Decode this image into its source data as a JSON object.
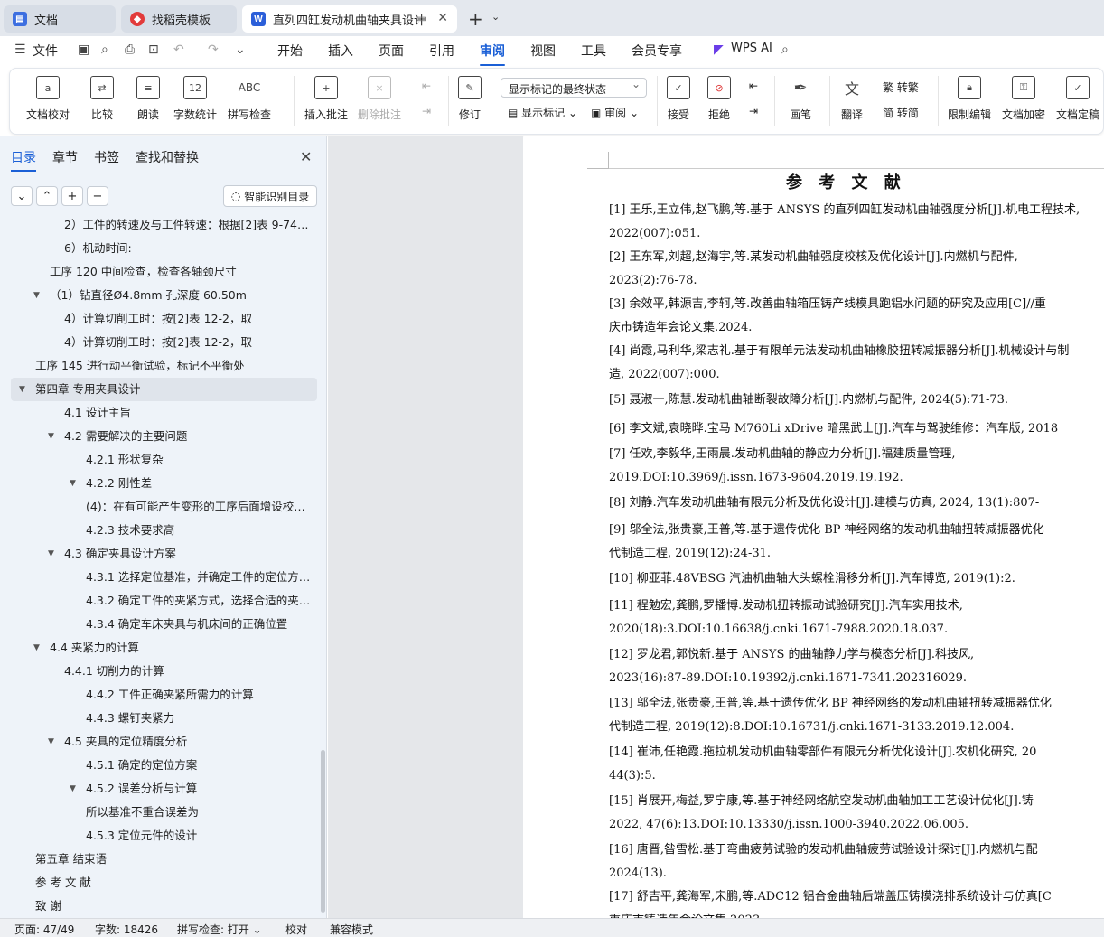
{
  "tabs": [
    {
      "label": "文档",
      "icon": "document-icon"
    },
    {
      "label": "找稻壳模板",
      "icon": "docer-icon"
    },
    {
      "label": "直列四缸发动机曲轴夹具设计",
      "icon": "word-icon"
    }
  ],
  "menu": {
    "file": "文件",
    "items": [
      "开始",
      "插入",
      "页面",
      "引用",
      "审阅",
      "视图",
      "工具",
      "会员专享"
    ],
    "active": "审阅",
    "wps_ai": "WPS AI"
  },
  "ribbon": {
    "proofread": "文档校对",
    "compare": "比较",
    "read_aloud": "朗读",
    "word_count": "字数统计",
    "word_count_glyph": "12",
    "spell_check": "拼写检查",
    "spell_glyph": "ABC",
    "insert_comment": "插入批注",
    "delete_comment": "删除批注",
    "revise": "修订",
    "markup_state": "显示标记的最终状态",
    "show_markup": "显示标记",
    "review": "审阅",
    "accept": "接受",
    "reject": "拒绝",
    "pen": "画笔",
    "translate": "翻译",
    "to_traditional": "转繁",
    "to_simplified": "转简",
    "restrict_edit": "限制编辑",
    "encrypt": "文档加密",
    "finalize": "文档定稿"
  },
  "nav": {
    "tabs": [
      "目录",
      "章节",
      "书签",
      "查找和替换"
    ],
    "active_tab": "目录",
    "smart_toc": "智能识别目录",
    "toc": [
      {
        "text": "2）工件的转速及与工件转速：根据[2]表 9-74，…",
        "indent": 2,
        "caret": false,
        "sel": false
      },
      {
        "text": "6）机动时间:",
        "indent": 2,
        "caret": false,
        "sel": false
      },
      {
        "text": "工序 120 中间检查，检查各轴颈尺寸",
        "indent": 1,
        "caret": false,
        "sel": false
      },
      {
        "text": "（1）钻直径Ø4.8mm 孔深度 60.50m",
        "indent": 1,
        "caret": true,
        "sel": false
      },
      {
        "text": "4）计算切削工时：按[2]表 12-2，取",
        "indent": 2,
        "caret": false,
        "sel": false
      },
      {
        "text": "4）计算切削工时：按[2]表 12-2，取",
        "indent": 2,
        "caret": false,
        "sel": false
      },
      {
        "text": "工序 145 进行动平衡试验，标记不平衡处",
        "indent": 0,
        "caret": false,
        "sel": false
      },
      {
        "text": "第四章   专用夹具设计",
        "indent": 0,
        "caret": true,
        "sel": true
      },
      {
        "text": "4.1   设计主旨",
        "indent": 2,
        "caret": false,
        "sel": false
      },
      {
        "text": "4.2   需要解决的主要问题",
        "indent": 2,
        "caret": true,
        "sel": false
      },
      {
        "text": "4.2.1   形状复杂",
        "indent": 3,
        "caret": false,
        "sel": false
      },
      {
        "text": "4.2.2   刚性差",
        "indent": 3,
        "caret": true,
        "sel": false
      },
      {
        "text": "(4)：在有可能产生变形的工序后面增设校…",
        "indent": 3,
        "caret": false,
        "sel": false
      },
      {
        "text": "4.2.3   技术要求高",
        "indent": 3,
        "caret": false,
        "sel": false
      },
      {
        "text": "4.3   确定夹具设计方案",
        "indent": 2,
        "caret": true,
        "sel": false
      },
      {
        "text": "4.3.1   选择定位基准，并确定工件的定位方…",
        "indent": 3,
        "caret": false,
        "sel": false
      },
      {
        "text": "4.3.2  确定工件的夹紧方式，选择合适的夹…",
        "indent": 3,
        "caret": false,
        "sel": false
      },
      {
        "text": "4.3.4   确定车床夹具与机床间的正确位置",
        "indent": 3,
        "caret": false,
        "sel": false
      },
      {
        "text": "4.4 夹紧力的计算",
        "indent": 1,
        "caret": true,
        "sel": false
      },
      {
        "text": "4.4.1 切削力的计算",
        "indent": 2,
        "caret": false,
        "sel": false
      },
      {
        "text": "4.4.2   工件正确夹紧所需力的计算",
        "indent": 3,
        "caret": false,
        "sel": false
      },
      {
        "text": "4.4.3   螺钉夹紧力",
        "indent": 3,
        "caret": false,
        "sel": false
      },
      {
        "text": "4.5   夹具的定位精度分析",
        "indent": 2,
        "caret": true,
        "sel": false
      },
      {
        "text": "4.5.1   确定的定位方案",
        "indent": 3,
        "caret": false,
        "sel": false
      },
      {
        "text": "4.5.2   误差分析与计算",
        "indent": 3,
        "caret": true,
        "sel": false
      },
      {
        "text": "所以基准不重合误差为",
        "indent": 3,
        "caret": false,
        "sel": false
      },
      {
        "text": "4.5.3   定位元件的设计",
        "indent": 3,
        "caret": false,
        "sel": false
      },
      {
        "text": "第五章  结束语",
        "indent": 0,
        "caret": false,
        "sel": false
      },
      {
        "text": "参 考 文 献",
        "indent": 0,
        "caret": false,
        "sel": false
      },
      {
        "text": "致     谢",
        "indent": 0,
        "caret": false,
        "sel": false
      }
    ]
  },
  "doc": {
    "title": "参 考 文 献",
    "lines": [
      "    [1] 王乐,王立伟,赵飞鹏,等.基于 ANSYS 的直列四缸发动机曲轴强度分析[J].机电工程技术,",
      "2022(007):051.",
      "    [2] 王东军,刘超,赵海宇,等.某发动机曲轴强度校核及优化设计[J].内燃机与配件,",
      "2023(2):76-78.",
      "    [3] 余效平,韩源吉,李轲,等.改善曲轴箱压铸产线模具跑铝水问题的研究及应用[C]//重",
      "庆市铸造年会论文集.2024.",
      "    [4] 尚霞,马利华,梁志礼.基于有限单元法发动机曲轴橡胶扭转减振器分析[J].机械设计与制",
      "造, 2022(007):000.",
      "    [5] 聂淑一,陈慧.发动机曲轴断裂故障分析[J].内燃机与配件, 2024(5):71-73.",
      "    [6] 李文斌,袁晓晔.宝马 M760Li xDrive 暗黑武士[J].汽车与驾驶维修：汽车版, 2018",
      "    [7] 任欢,李毅华,王雨晨.发动机曲轴的静应力分析[J].福建质量管理,",
      "2019.DOI:10.3969/j.issn.1673-9604.2019.19.192.",
      "    [8] 刘静.汽车发动机曲轴有限元分析及优化设计[J].建模与仿真, 2024, 13(1):807-",
      "    [9] 邬全法,张贵豪,王普,等.基于遗传优化 BP 神经网络的发动机曲轴扭转减振器优化",
      "代制造工程, 2019(12):24-31.",
      "    [10] 柳亚菲.48VBSG 汽油机曲轴大头螺栓滑移分析[J].汽车博览, 2019(1):2.",
      "    [11] 程勉宏,龚鹏,罗播博.发动机扭转振动试验研究[J].汽车实用技术,",
      "2020(18):3.DOI:10.16638/j.cnki.1671-7988.2020.18.037.",
      "    [12] 罗龙君,郭悦新.基于 ANSYS 的曲轴静力学与模态分析[J].科技风,",
      "2023(16):87-89.DOI:10.19392/j.cnki.1671-7341.202316029.",
      "    [13] 邬全法,张贵豪,王普,等.基于遗传优化 BP 神经网络的发动机曲轴扭转减振器优化",
      "代制造工程, 2019(12):8.DOI:10.16731/j.cnki.1671-3133.2019.12.004.",
      "    [14] 崔沛,任艳霞.拖拉机发动机曲轴零部件有限元分析优化设计[J].农机化研究, 20",
      "44(3):5.",
      "    [15] 肖展开,梅益,罗宁康,等.基于神经网络航空发动机曲轴加工工艺设计优化[J].铸",
      "2022, 47(6):13.DOI:10.13330/j.issn.1000-3940.2022.06.005.",
      "    [16] 唐晋,昝雪松.基于弯曲疲劳试验的发动机曲轴疲劳试验设计探讨[J].内燃机与配",
      "2024(13).",
      "    [17] 舒吉平,龚海军,宋鹏,等.ADC12 铝合金曲轴后端盖压铸模浇排系统设计与仿真[C",
      "重庆市铸造年会论文集.2023."
    ]
  },
  "status": {
    "page": "页面: 47/49",
    "words": "字数: 18426",
    "spell": "拼写检查: 打开",
    "proof": "校对",
    "compat": "兼容模式"
  }
}
